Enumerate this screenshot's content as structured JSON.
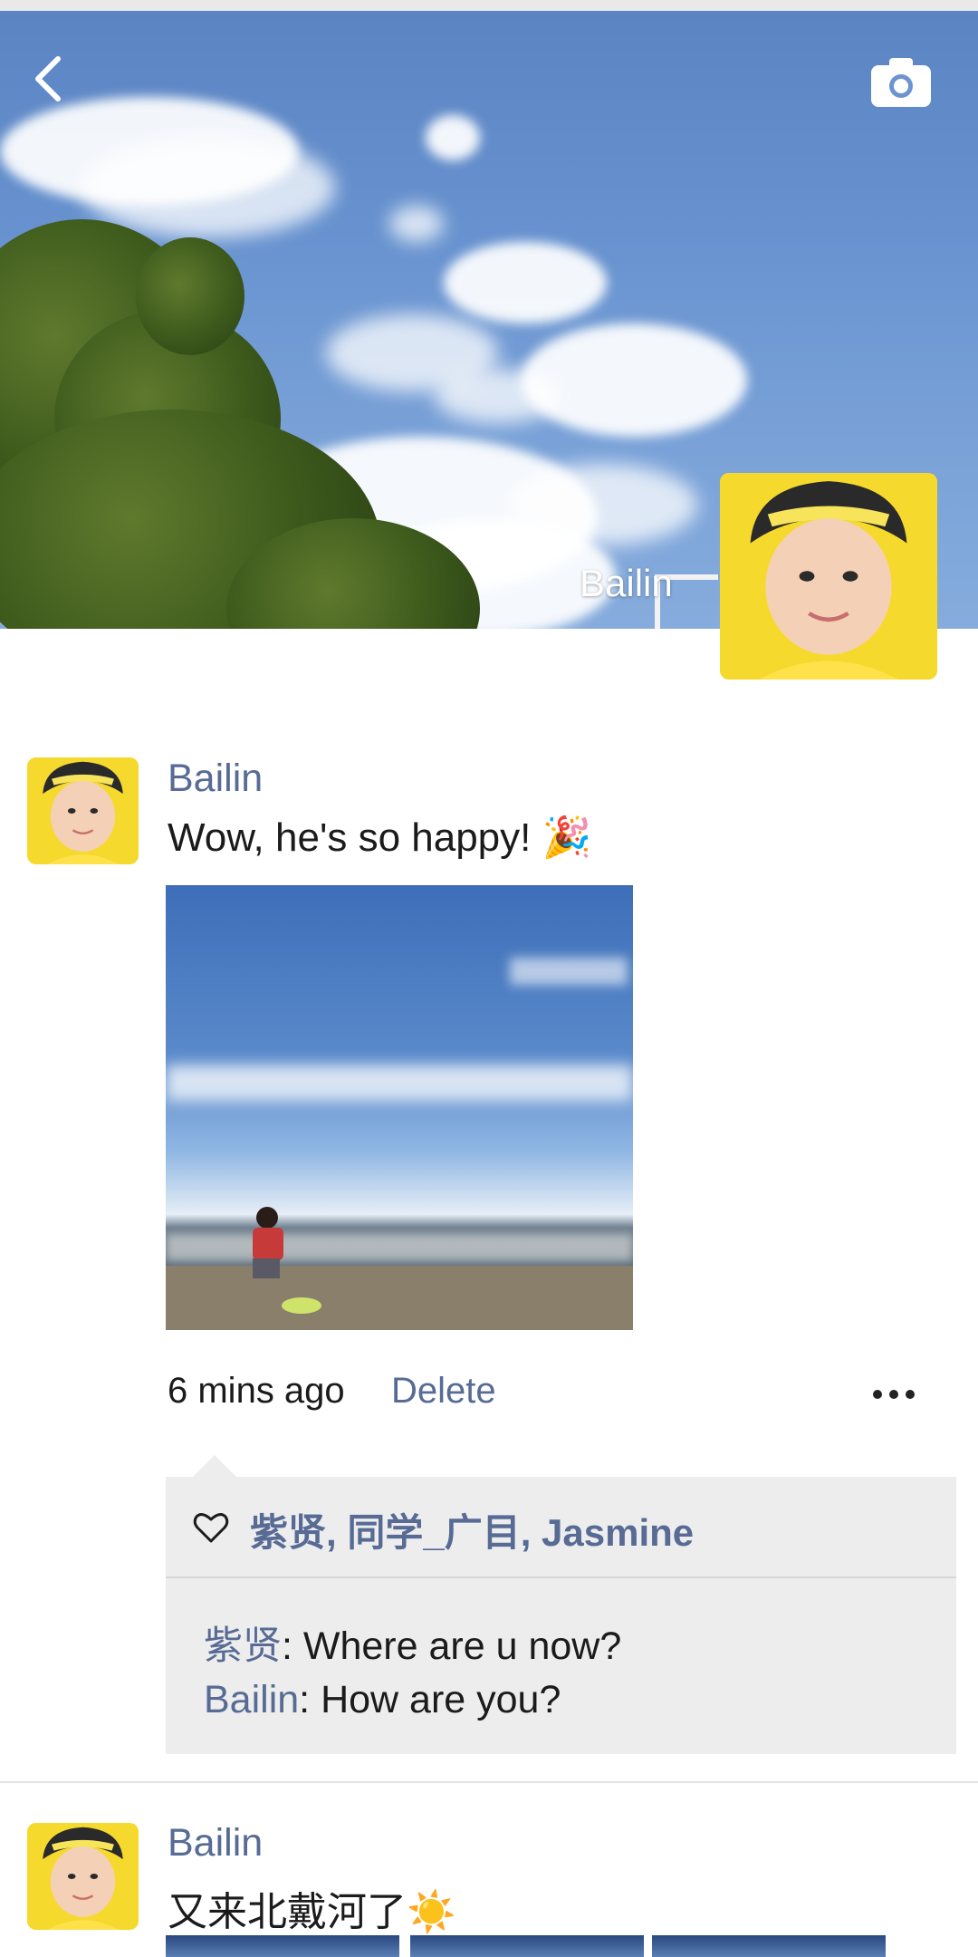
{
  "cover": {
    "owner_name": "Bailin"
  },
  "posts": [
    {
      "author": "Bailin",
      "text": "Wow, he's so happy! 🎉",
      "time": "6 mins ago",
      "delete_label": "Delete",
      "likes": "紫贤, 同学_广目, Jasmine",
      "comments": [
        {
          "name": "紫贤",
          "text": ": Where are u now?"
        },
        {
          "name": "Bailin",
          "text": ": How are you?"
        }
      ]
    },
    {
      "author": "Bailin",
      "text": "又来北戴河了☀️"
    }
  ],
  "colors": {
    "link": "#576b95",
    "avatar_bg": "#f6d92d",
    "comment_bg": "#ededed"
  },
  "icons": [
    "back-arrow-icon",
    "camera-icon",
    "heart-icon",
    "more-dots-icon"
  ]
}
